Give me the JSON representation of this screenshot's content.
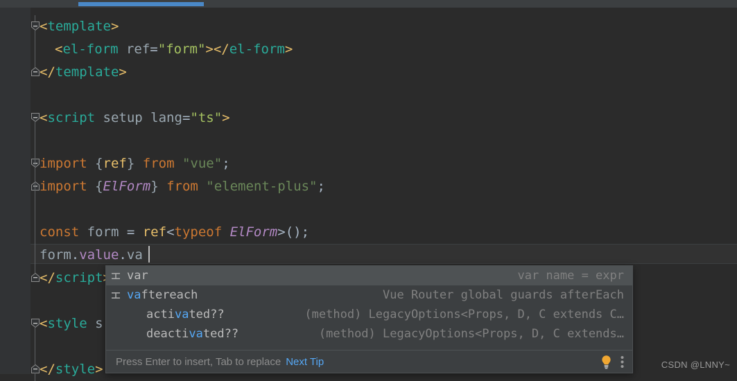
{
  "window": {
    "topbar": {
      "progress_label": ""
    }
  },
  "editor": {
    "language": "vue-sfc",
    "caret": {
      "line": 9,
      "column": 14
    },
    "lines": [
      {
        "indent": 0,
        "fold": "start",
        "tokens": [
          {
            "t": "tagb",
            "v": "<"
          },
          {
            "t": "tagn",
            "v": "template"
          },
          {
            "t": "tagb",
            "v": ">"
          }
        ]
      },
      {
        "indent": 1,
        "fold": null,
        "tokens": [
          {
            "t": "tagb",
            "v": "<"
          },
          {
            "t": "tagn",
            "v": "el-form"
          },
          {
            "t": "attr",
            "v": " ref"
          },
          {
            "t": "punc",
            "v": "="
          },
          {
            "t": "astr",
            "v": "\"form\""
          },
          {
            "t": "tagb",
            "v": ">"
          },
          {
            "t": "tagb",
            "v": "</"
          },
          {
            "t": "tagn",
            "v": "el-form"
          },
          {
            "t": "tagb",
            "v": ">"
          }
        ]
      },
      {
        "indent": 0,
        "fold": "end",
        "tokens": [
          {
            "t": "tagb",
            "v": "</"
          },
          {
            "t": "tagn",
            "v": "template"
          },
          {
            "t": "tagb",
            "v": ">"
          }
        ]
      },
      {
        "indent": 0,
        "fold": null,
        "tokens": []
      },
      {
        "indent": 0,
        "fold": "start",
        "tokens": [
          {
            "t": "tagb",
            "v": "<"
          },
          {
            "t": "tagn",
            "v": "script"
          },
          {
            "t": "attr",
            "v": " setup"
          },
          {
            "t": "attr",
            "v": " lang"
          },
          {
            "t": "punc",
            "v": "="
          },
          {
            "t": "astr",
            "v": "\"ts\""
          },
          {
            "t": "tagb",
            "v": ">"
          }
        ]
      },
      {
        "indent": 0,
        "fold": null,
        "tokens": []
      },
      {
        "indent": 0,
        "fold": "start",
        "tokens": [
          {
            "t": "kw",
            "v": "import"
          },
          {
            "t": "punc",
            "v": " "
          },
          {
            "t": "brace",
            "v": "{"
          },
          {
            "t": "fn",
            "v": "ref"
          },
          {
            "t": "brace",
            "v": "}"
          },
          {
            "t": "kw",
            "v": " from"
          },
          {
            "t": "punc",
            "v": " "
          },
          {
            "t": "str",
            "v": "\"vue\""
          },
          {
            "t": "punc",
            "v": ";"
          }
        ]
      },
      {
        "indent": 0,
        "fold": "end",
        "tokens": [
          {
            "t": "kw",
            "v": "import"
          },
          {
            "t": "punc",
            "v": " "
          },
          {
            "t": "brace",
            "v": "{"
          },
          {
            "t": "cls",
            "v": "ElForm"
          },
          {
            "t": "brace",
            "v": "}"
          },
          {
            "t": "kw",
            "v": " from"
          },
          {
            "t": "punc",
            "v": " "
          },
          {
            "t": "str",
            "v": "\"element-plus\""
          },
          {
            "t": "punc",
            "v": ";"
          }
        ]
      },
      {
        "indent": 0,
        "fold": null,
        "tokens": []
      },
      {
        "indent": 0,
        "fold": null,
        "tokens": [
          {
            "t": "kw",
            "v": "const"
          },
          {
            "t": "attr",
            "v": " form"
          },
          {
            "t": "op",
            "v": " = "
          },
          {
            "t": "fn",
            "v": "ref"
          },
          {
            "t": "punc",
            "v": "<"
          },
          {
            "t": "kw",
            "v": "typeof"
          },
          {
            "t": "punc",
            "v": " "
          },
          {
            "t": "cls",
            "v": "ElForm"
          },
          {
            "t": "punc",
            "v": ">"
          },
          {
            "t": "punc",
            "v": "()"
          },
          {
            "t": "punc",
            "v": ";"
          }
        ]
      },
      {
        "indent": 0,
        "fold": null,
        "current": true,
        "tokens": [
          {
            "t": "attr",
            "v": "form"
          },
          {
            "t": "punc",
            "v": "."
          },
          {
            "t": "prop",
            "v": "value"
          },
          {
            "t": "punc",
            "v": "."
          },
          {
            "t": "attr",
            "v": "va"
          }
        ]
      },
      {
        "indent": 0,
        "fold": "end",
        "tokens": [
          {
            "t": "tagb",
            "v": "</"
          },
          {
            "t": "tagn",
            "v": "script"
          },
          {
            "t": "tagb",
            "v": ">"
          }
        ]
      },
      {
        "indent": 0,
        "fold": null,
        "tokens": []
      },
      {
        "indent": 0,
        "fold": "start",
        "tokens": [
          {
            "t": "tagb",
            "v": "<"
          },
          {
            "t": "tagn",
            "v": "style"
          },
          {
            "t": "attr",
            "v": " s"
          }
        ]
      },
      {
        "indent": 0,
        "fold": null,
        "tokens": []
      },
      {
        "indent": 0,
        "fold": "end",
        "tokens": [
          {
            "t": "tagb",
            "v": "</"
          },
          {
            "t": "tagn",
            "v": "style"
          },
          {
            "t": "tagb",
            "v": ">"
          }
        ]
      }
    ]
  },
  "completion_popup": {
    "prefix": "va",
    "items": [
      {
        "icon": "live-template-icon",
        "label_prefix": "",
        "label_match": "",
        "label_rest": "var",
        "type_text": "var name = expr",
        "selected": true,
        "indented": false
      },
      {
        "icon": "live-template-icon",
        "label_prefix": "",
        "label_match": "va",
        "label_rest": "ftereach",
        "type_text": "Vue Router global guards afterEach",
        "selected": false,
        "indented": false
      },
      {
        "icon": "none",
        "label_prefix": "acti",
        "label_match": "va",
        "label_rest": "ted??",
        "type_text": "(method) LegacyOptions<Props, D, C extends C…",
        "selected": false,
        "indented": true
      },
      {
        "icon": "none",
        "label_prefix": "deacti",
        "label_match": "va",
        "label_rest": "ted??",
        "type_text": "(method) LegacyOptions<Props, D, C extends…",
        "selected": false,
        "indented": true
      }
    ],
    "footer": {
      "hint": "Press Enter to insert, Tab to replace",
      "link": "Next Tip",
      "bulb_icon": "lightbulb-icon",
      "menu_icon": "kebab-menu-icon"
    }
  },
  "watermark": {
    "text": "CSDN @LNNY~"
  },
  "colors": {
    "editor_bg": "#2b2b2b",
    "gutter_bg": "#313335",
    "popup_bg": "#3c3f41",
    "popup_selected": "#4e5254",
    "accent_blue": "#56a8f5",
    "progress_blue": "#4a88c7",
    "bulb_yellow": "#f0a732"
  }
}
